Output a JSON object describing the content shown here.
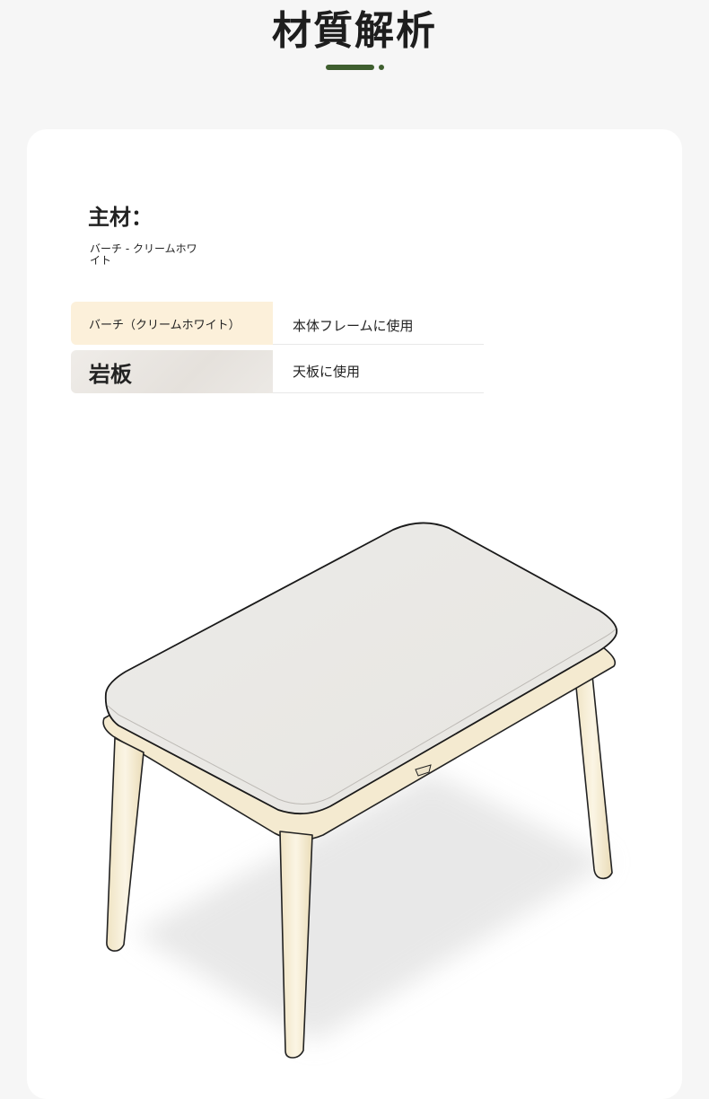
{
  "header": {
    "title": "材質解析"
  },
  "card": {
    "main_material_label": "主材：",
    "main_material_desc": "バーチ - クリームホワイト",
    "materials": [
      {
        "name": "バーチ（クリームホワイト）",
        "use": "本体フレームに使用"
      },
      {
        "name": "岩板",
        "use": "天板に使用"
      }
    ]
  },
  "colors": {
    "accent": "#3f5f2f",
    "birch_highlight": "#fcf0da",
    "stone_highlight": "#e8e4df",
    "tabletop": "#eae8e5",
    "frame": "#f5ecd4"
  }
}
